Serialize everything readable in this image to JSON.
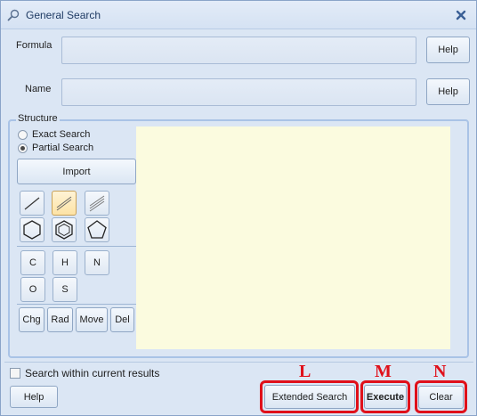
{
  "window": {
    "title": "General Search",
    "title_icon": "search-icon",
    "close_icon": "close-icon"
  },
  "formula": {
    "label": "Formula",
    "value": "",
    "help_label": "Help"
  },
  "name": {
    "label": "Name",
    "value": "",
    "help_label": "Help"
  },
  "structure": {
    "legend": "Structure",
    "search_modes": [
      {
        "label": "Exact Search",
        "checked": false
      },
      {
        "label": "Partial Search",
        "checked": true
      }
    ],
    "import_label": "Import",
    "bond_tools": [
      "single-bond-icon",
      "double-bond-icon",
      "triple-bond-icon"
    ],
    "ring_tools": [
      "cyclohexane-icon",
      "benzene-icon",
      "cyclopentane-icon"
    ],
    "selected_tool": "double-bond-icon",
    "atoms": [
      "C",
      "H",
      "N",
      "O",
      "S"
    ],
    "edit_tools": [
      "Chg",
      "Rad",
      "Move",
      "Del"
    ],
    "canvas_color": "#fbfbdf"
  },
  "search_within_results": {
    "label": "Search within current results",
    "checked": false
  },
  "footer": {
    "help_label": "Help",
    "extended_search_label": "Extended Search",
    "execute_label": "Execute",
    "clear_label": "Clear"
  },
  "annotations": {
    "letters": [
      "L",
      "M",
      "N"
    ],
    "color": "#e0101a"
  }
}
